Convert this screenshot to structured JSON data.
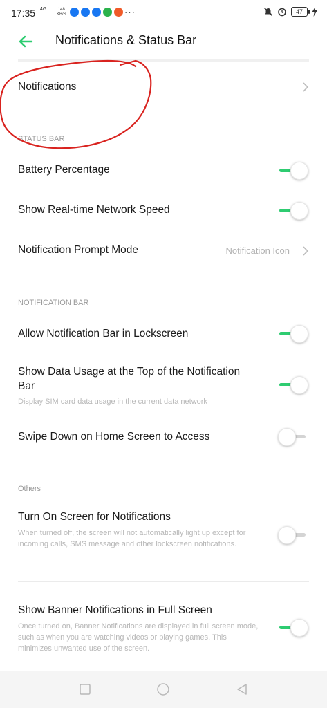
{
  "status_bar": {
    "time": "17:35",
    "signal": "4G",
    "speed_value": "148",
    "speed_unit": "KB/S",
    "more": "···",
    "battery": "47",
    "app_icon_colors": [
      "#1877f2",
      "#1877f2",
      "#1877f2",
      "#2bb24c",
      "#f05a28"
    ]
  },
  "header": {
    "title": "Notifications & Status Bar",
    "accent_color": "#2ecc71"
  },
  "rows": {
    "notifications": "Notifications",
    "status_bar_section": "STATUS BAR",
    "battery_percentage": "Battery Percentage",
    "network_speed": "Show Real-time Network Speed",
    "prompt_mode": "Notification Prompt Mode",
    "prompt_mode_value": "Notification Icon",
    "notification_bar_section": "NOTIFICATION BAR",
    "allow_lockscreen": "Allow Notification Bar in Lockscreen",
    "data_usage": "Show Data Usage at the Top of the Notification Bar",
    "data_usage_desc": "Display SIM card data usage in the current data network",
    "swipe_down": "Swipe Down on Home Screen to Access",
    "others_section": "Others",
    "turn_on_screen": "Turn On Screen for Notifications",
    "turn_on_screen_desc": "When turned off, the screen will not automatically light up except for incoming calls, SMS message and other lockscreen notifications.",
    "banner_fullscreen": "Show Banner Notifications in Full Screen",
    "banner_fullscreen_desc": "Once turned on, Banner Notifications are displayed in full screen mode, such as when you are watching videos or playing games. This minimizes unwanted use of the screen."
  },
  "toggles": {
    "battery_percentage": true,
    "network_speed": true,
    "allow_lockscreen": true,
    "data_usage": true,
    "swipe_down": false,
    "turn_on_screen": false,
    "banner_fullscreen": true
  },
  "annotation_color": "#d9231f"
}
